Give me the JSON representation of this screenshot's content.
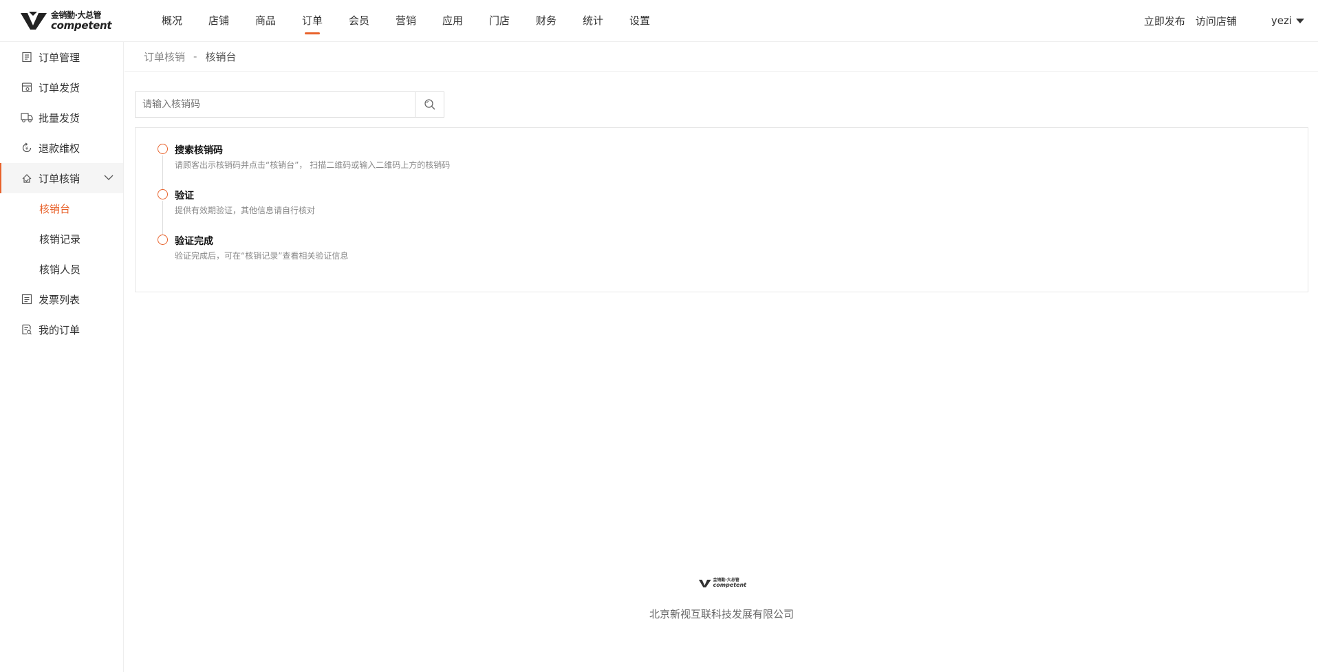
{
  "logo": {
    "cn": "金销勤·大总管",
    "en": "competent"
  },
  "topnav": [
    "概况",
    "店铺",
    "商品",
    "订单",
    "会员",
    "营销",
    "应用",
    "门店",
    "财务",
    "统计",
    "设置"
  ],
  "header": {
    "publish": "立即发布",
    "visit_store": "访问店铺",
    "username": "yezi"
  },
  "sidebar": {
    "items": [
      {
        "label": "订单管理",
        "icon": "order-list-icon"
      },
      {
        "label": "订单发货",
        "icon": "delivery-icon"
      },
      {
        "label": "批量发货",
        "icon": "truck-icon"
      },
      {
        "label": "退款维权",
        "icon": "refund-icon"
      },
      {
        "label": "订单核销",
        "icon": "verify-icon"
      },
      {
        "label": "发票列表",
        "icon": "invoice-icon"
      },
      {
        "label": "我的订单",
        "icon": "my-order-icon"
      }
    ],
    "sub_items": [
      "核销台",
      "核销记录",
      "核销人员"
    ]
  },
  "breadcrumb": {
    "parent": "订单核销",
    "separator": "-",
    "current": "核销台"
  },
  "search": {
    "placeholder": "请输入核销码"
  },
  "steps": [
    {
      "title": "搜索核销码",
      "desc": "请顾客出示核销码并点击“核销台”， 扫描二维码或输入二维码上方的核销码"
    },
    {
      "title": "验证",
      "desc": "提供有效期验证，其他信息请自行核对"
    },
    {
      "title": "验证完成",
      "desc": "验证完成后，可在“核销记录”查看相关验证信息"
    }
  ],
  "footer": {
    "logo_cn": "金销勤·大总管",
    "logo_en": "competent",
    "company": "北京新视互联科技发展有限公司"
  },
  "colors": {
    "accent": "#e8622b"
  }
}
